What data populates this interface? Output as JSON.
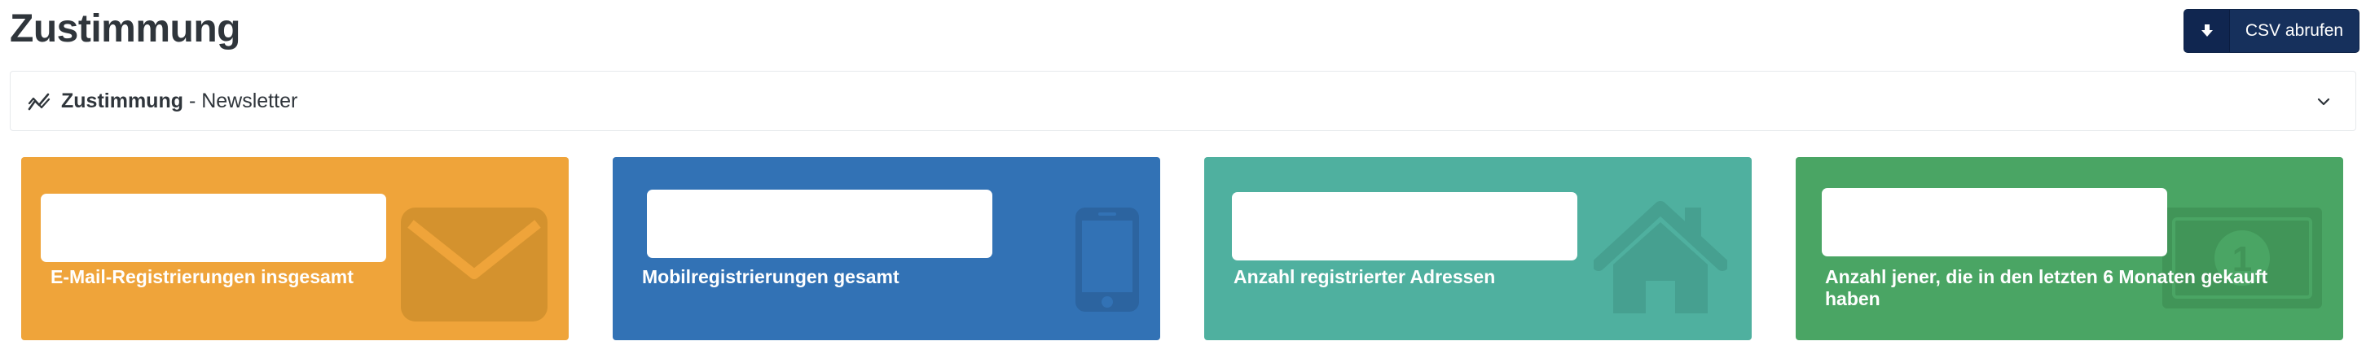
{
  "page": {
    "title": "Zustimmung"
  },
  "toolbar": {
    "csv_icon": "download-icon",
    "csv_label": "CSV abrufen"
  },
  "panel": {
    "icon": "line-chart-icon",
    "title_bold": "Zustimmung",
    "title_rest": " - Newsletter",
    "toggle_icon": "chevron-down-icon"
  },
  "cards": [
    {
      "label": "E-Mail-Registrierungen insgesamt",
      "value": "",
      "icon": "envelope-icon",
      "color": "#efa43a"
    },
    {
      "label": "Mobilregistrierungen gesamt",
      "value": "",
      "icon": "mobile-phone-icon",
      "color": "#3272b5"
    },
    {
      "label": "Anzahl registrierter Adressen",
      "value": "",
      "icon": "home-icon",
      "color": "#4fb09f"
    },
    {
      "label": "Anzahl jener, die in den letzten 6 Monaten gekauft haben",
      "value": "",
      "icon": "money-bill-icon",
      "color": "#4aa564"
    }
  ]
}
